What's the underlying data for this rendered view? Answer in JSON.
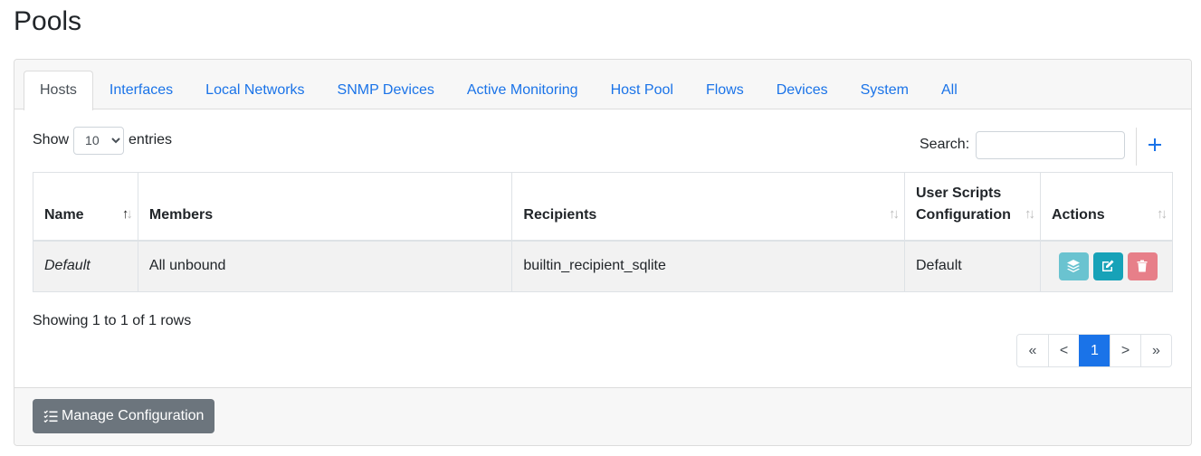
{
  "page": {
    "title": "Pools"
  },
  "tabs": [
    {
      "label": "Hosts",
      "active": true
    },
    {
      "label": "Interfaces"
    },
    {
      "label": "Local Networks"
    },
    {
      "label": "SNMP Devices"
    },
    {
      "label": "Active Monitoring"
    },
    {
      "label": "Host Pool"
    },
    {
      "label": "Flows"
    },
    {
      "label": "Devices"
    },
    {
      "label": "System"
    },
    {
      "label": "All"
    }
  ],
  "length": {
    "show_label": "Show",
    "selected": "10",
    "entries_label": "entries"
  },
  "search": {
    "label": "Search:",
    "value": ""
  },
  "add_icon": "plus-icon",
  "table": {
    "columns": [
      "Name",
      "Members",
      "Recipients",
      "User Scripts Configuration",
      "Actions"
    ],
    "rows": [
      {
        "name": "Default",
        "members": "All unbound",
        "recipients": "builtin_recipient_sqlite",
        "config": "Default"
      }
    ]
  },
  "status_text": "Showing 1 to 1 of 1 rows",
  "pagination": {
    "first": "«",
    "prev": "<",
    "current": "1",
    "next": ">",
    "last": "»"
  },
  "footer": {
    "manage_label": "Manage Configuration"
  },
  "colors": {
    "accent": "#1a73e8",
    "info": "#6ac3d0",
    "edit": "#17a2b8",
    "danger": "#e77f89",
    "secondary": "#6c757d"
  }
}
